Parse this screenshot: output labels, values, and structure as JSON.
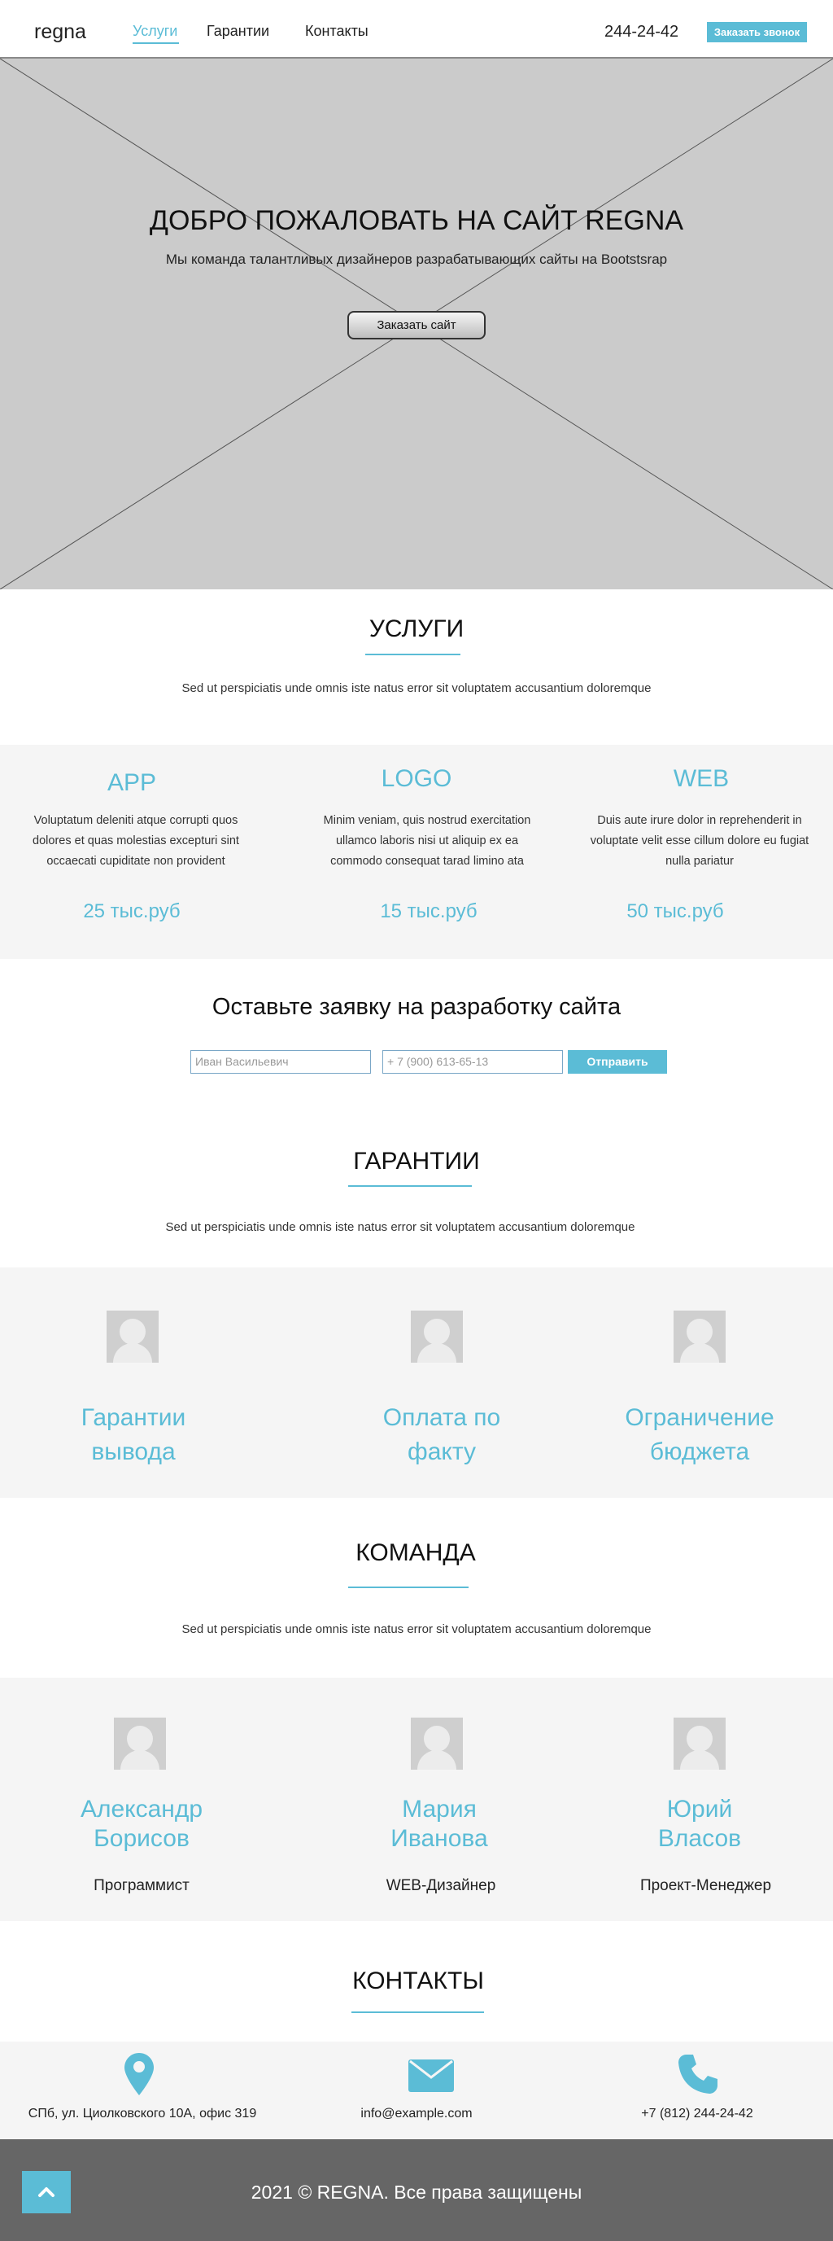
{
  "header": {
    "logo": "regna",
    "nav": [
      "Услуги",
      "Гарантии",
      "Контакты"
    ],
    "phone": "244-24-42",
    "callback_label": "Заказать звонок"
  },
  "hero": {
    "title": "ДОБРО ПОЖАЛОВАТЬ НА САЙТ REGNA",
    "subtitle": "Мы команда талантливых дизайнеров разрабатывающих сайты на Bootstsrap",
    "button": "Заказать сайт"
  },
  "services": {
    "title": "УСЛУГИ",
    "text": "Sed ut perspiciatis unde omnis iste natus error sit voluptatem accusantium doloremque",
    "items": [
      {
        "title": "APP",
        "desc": "Voluptatum deleniti atque corrupti quos dolores et quas molestias excepturi sint occaecati cupiditate non provident",
        "price": "25 тыс.руб"
      },
      {
        "title": "LOGO",
        "desc": "Minim veniam, quis nostrud exercitation ullamco laboris nisi ut aliquip ex ea commodo consequat tarad limino ata",
        "price": "15 тыс.руб"
      },
      {
        "title": "WEB",
        "desc": "Duis aute irure dolor in reprehenderit in voluptate velit esse cillum dolore eu fugiat nulla pariatur",
        "price": "50 тыс.руб"
      }
    ]
  },
  "request": {
    "title": "Оставьте заявку на разработку сайта",
    "name_placeholder": "Иван Васильевич",
    "phone_placeholder": "+ 7 (900) 613-65-13",
    "submit": "Отправить"
  },
  "guarantees": {
    "title": "ГАРАНТИИ",
    "text": "Sed ut perspiciatis unde omnis iste natus error sit voluptatem accusantium doloremque",
    "items": [
      {
        "line1": "Гарантии",
        "line2": "вывода"
      },
      {
        "line1": "Оплата по",
        "line2": "факту"
      },
      {
        "line1": "Ограничение",
        "line2": "бюджета"
      }
    ]
  },
  "team": {
    "title": "КОМАНДА",
    "text": "Sed ut perspiciatis unde omnis iste natus error sit voluptatem accusantium doloremque",
    "members": [
      {
        "first": "Александр",
        "last": "Борисов",
        "role": "Программист"
      },
      {
        "first": "Мария",
        "last": "Иванова",
        "role": "WEB-Дизайнер"
      },
      {
        "first": "Юрий",
        "last": "Власов",
        "role": "Проект-Менеджер"
      }
    ]
  },
  "contacts": {
    "title": "КОНТАКТЫ",
    "address": "СПб, ул. Циолковского 10А, офис 319",
    "email": "info@example.com",
    "phone": "+7 (812) 244-24-42",
    "icons": [
      "map-pin-icon",
      "envelope-icon",
      "phone-icon"
    ]
  },
  "footer": {
    "text": "2021 © REGNA. Все права защищены"
  },
  "colors": {
    "accent": "#5bbcd6",
    "hero_bg": "#cbcbcb",
    "band_bg": "#f5f5f5",
    "footer_bg": "#666666"
  }
}
